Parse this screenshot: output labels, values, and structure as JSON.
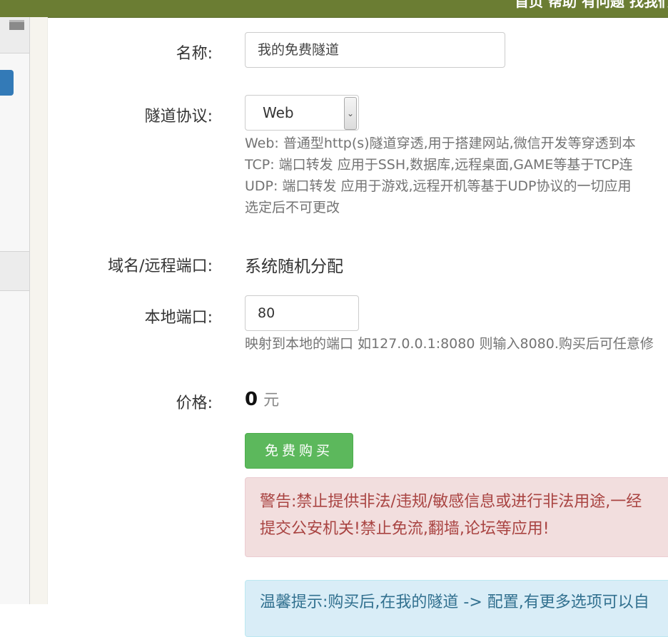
{
  "topbar": {
    "links_text": "首页   帮助   有问题   找我们"
  },
  "form": {
    "name": {
      "label": "名称:",
      "value": "我的免费隧道"
    },
    "protocol": {
      "label": "隧道协议:",
      "selected": "Web",
      "help": [
        "Web: 普通型http(s)隧道穿透,用于搭建网站,微信开发等穿透到本",
        "TCP: 端口转发 应用于SSH,数据库,远程桌面,GAME等基于TCP连",
        "UDP: 端口转发 应用于游戏,远程开机等基于UDP协议的一切应用",
        "选定后不可更改"
      ]
    },
    "remote": {
      "label": "域名/远程端口:",
      "value": "系统随机分配"
    },
    "local_port": {
      "label": "本地端口:",
      "value": "80",
      "help": "映射到本地的端口 如127.0.0.1:8080 则输入8080.购买后可任意修"
    },
    "price": {
      "label": "价格:",
      "amount": "0",
      "unit": "元"
    },
    "buy_button": "免费购买"
  },
  "alerts": {
    "warning": [
      "警告:禁止提供非法/违规/敏感信息或进行非法用途,一经",
      "提交公安机关!禁止免流,翻墙,论坛等应用!"
    ],
    "tip": "温馨提示:购买后,在我的隧道 -> 配置,有更多选项可以自"
  },
  "colors": {
    "topbar": "#6b7d33",
    "button_success": "#5cb85c",
    "alert_danger_bg": "#f2dede",
    "alert_danger_text": "#a94442",
    "alert_info_bg": "#d9edf7",
    "sidebar_active": "#337ab7"
  }
}
